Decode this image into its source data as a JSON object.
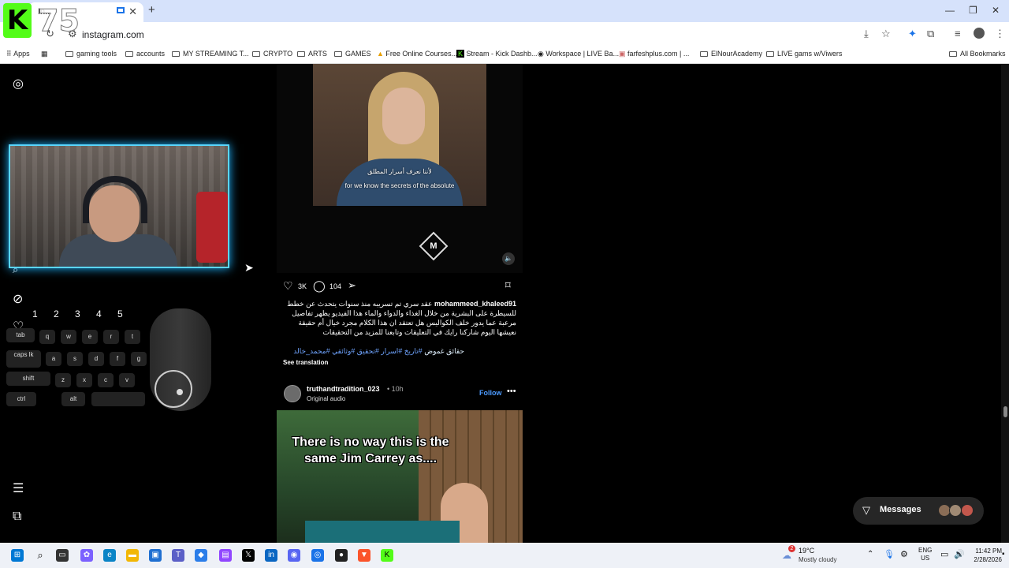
{
  "browser": {
    "tab_title": "In...",
    "url": "instagram.com",
    "bookmarks": [
      "Apps",
      "gaming tools",
      "accounts",
      "MY STREAMING T...",
      "CRYPTO",
      "ARTS",
      "GAMES",
      "Free Online Courses...",
      "Stream - Kick Dashb...",
      "Workspace | LIVE Ba...",
      "farfeshplus.com | ...",
      "ElNourAcademy",
      "LIVE gams w/Viwers",
      "All Bookmarks"
    ]
  },
  "overlay": {
    "badge_number": "75",
    "keys_numbers": [
      "1",
      "2",
      "3",
      "4",
      "5"
    ],
    "keys": [
      "tab",
      "q",
      "w",
      "e",
      "r",
      "t",
      "caps lk",
      "a",
      "s",
      "d",
      "f",
      "g",
      "shift",
      "z",
      "x",
      "c",
      "v",
      "ctrl",
      "alt"
    ]
  },
  "post1": {
    "subtitle_ar": "لأننا نعرف أسرار المطلق",
    "subtitle_en": "for we know the secrets of the absolute",
    "logo_letter": "M",
    "likes": "3K",
    "comments": "104",
    "username": "mohammeed_khaleed91",
    "caption": "عقد سري تم تسريبه منذ سنوات يتحدث عن خطط للسيطرة على البشرية من خلال الغذاء والدواء والماء هذا الفيديو يظهر تفاصيل مرعبة عما يدور خلف الكواليس هل تعتقد ان هذا الكلام مجرد خيال أم حقيقة نعيشها اليوم شاركنا رايك في التعليقات وتابعنا للمزيد من التحقيقات",
    "hashtags_plain": "حقائق غموض",
    "hashtags": "#تاريخ #اسرار #تحقيق #وثائقي #محمد_خالد",
    "see_translation": "See translation"
  },
  "post2": {
    "username": "truthandtradition_023",
    "time": "10h",
    "audio": "Original audio",
    "follow": "Follow",
    "meme_text": "There is no way this is the same Jim Carrey as...."
  },
  "messages": {
    "label": "Messages"
  },
  "taskbar": {
    "weather_temp": "19°C",
    "weather_desc": "Mostly cloudy",
    "weather_badge": "2",
    "lang": "ENG",
    "region": "US",
    "time": "11:42 PM",
    "date": "2/28/2026"
  },
  "colors": {
    "accent": "#4c9bff",
    "kick_green": "#53fc18",
    "webcam_glow": "#5ad6ff"
  }
}
